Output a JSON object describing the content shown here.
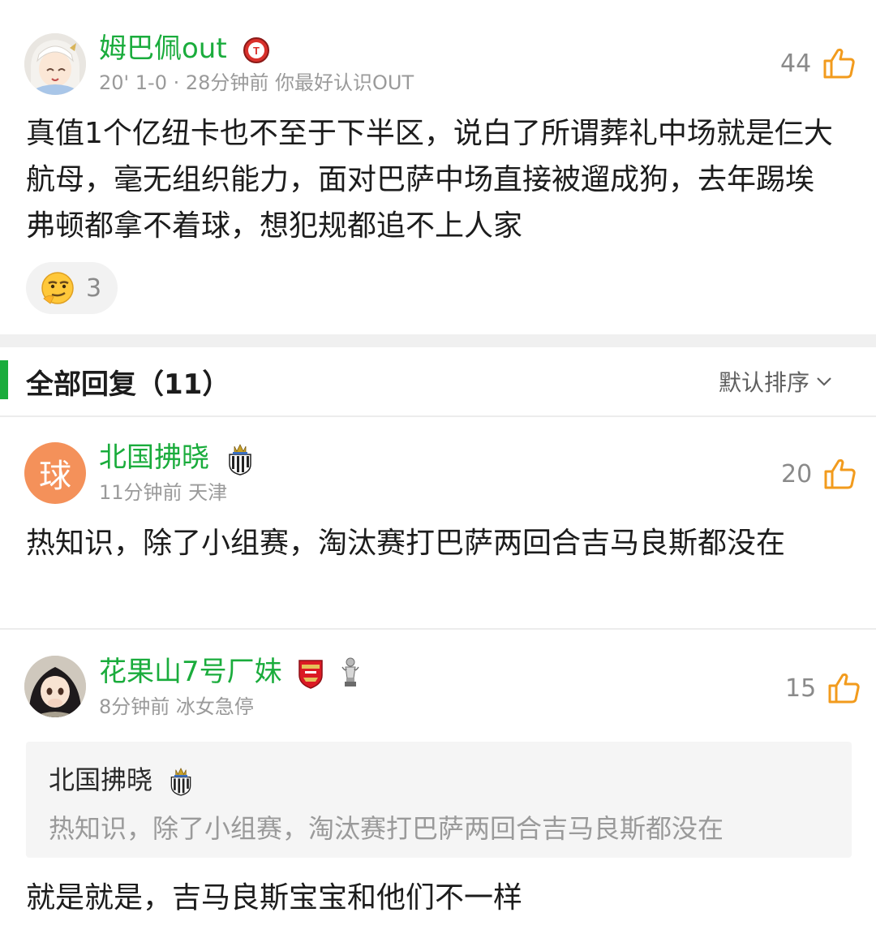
{
  "main_comment": {
    "username": "姆巴佩out",
    "meta": "20' 1-0 · 28分钟前 你最好认识OUT",
    "like_count": "44",
    "text": "真值1个亿纽卡也不至于下半区，说白了所谓葬礼中场就是仨大航母，毫无组织能力，面对巴萨中场直接被遛成狗，去年踢埃弗顿都拿不着球，想犯规都追不上人家",
    "reaction": {
      "icon": "smirk-emoji-icon",
      "count": "3"
    }
  },
  "replies_header": {
    "title": "全部回复（11）",
    "sort_label": "默认排序"
  },
  "replies": [
    {
      "username": "北国拂晓",
      "avatar_text": "球",
      "meta": "11分钟前 天津",
      "like_count": "20",
      "text": "热知识，除了小组赛，淘汰赛打巴萨两回合吉马良斯都没在"
    },
    {
      "username": "花果山7号厂妹",
      "meta": "8分钟前 冰女急停",
      "like_count": "15",
      "quote": {
        "username": "北国拂晓",
        "text": "热知识，除了小组赛，淘汰赛打巴萨两回合吉马良斯都没在"
      },
      "text": "就是就是，吉马良斯宝宝和他们不一样"
    }
  ],
  "colors": {
    "username_green": "#1aac3c",
    "like_orange": "#f29b1d",
    "avatar_orange": "#f4915a",
    "meta_gray": "#9a9a9a"
  }
}
